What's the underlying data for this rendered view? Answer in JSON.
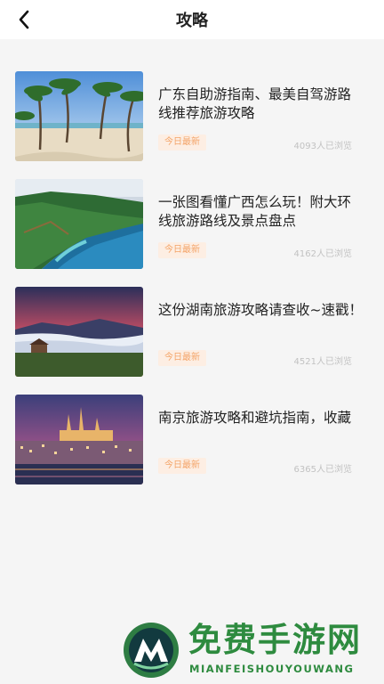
{
  "header": {
    "title": "攻略"
  },
  "items": [
    {
      "title": "广东自助游指南、最美自驾游路线推荐旅游攻略",
      "badge": "今日最新",
      "views": "4093人已浏览",
      "image": "tropical-beach-palms"
    },
    {
      "title": "一张图看懂广西怎么玩！附大环线旅游路线及景点盘点",
      "badge": "今日最新",
      "views": "4162人已浏览",
      "image": "coastal-cliffs-sea"
    },
    {
      "title": "这份湖南旅游攻略请查收~速戳！",
      "badge": "今日最新",
      "views": "4521人已浏览",
      "image": "mountain-sunrise-fog"
    },
    {
      "title": "南京旅游攻略和避坑指南，收藏",
      "badge": "今日最新",
      "views": "6365人已浏览",
      "image": "castle-city-night"
    }
  ],
  "watermark": {
    "text": "免费手游网",
    "sub": "MIANFEISHOUYOUWANG"
  },
  "colors": {
    "badge_bg": "#fdeee3",
    "badge_text": "#f4a468",
    "watermark": "#2e8b3f"
  }
}
